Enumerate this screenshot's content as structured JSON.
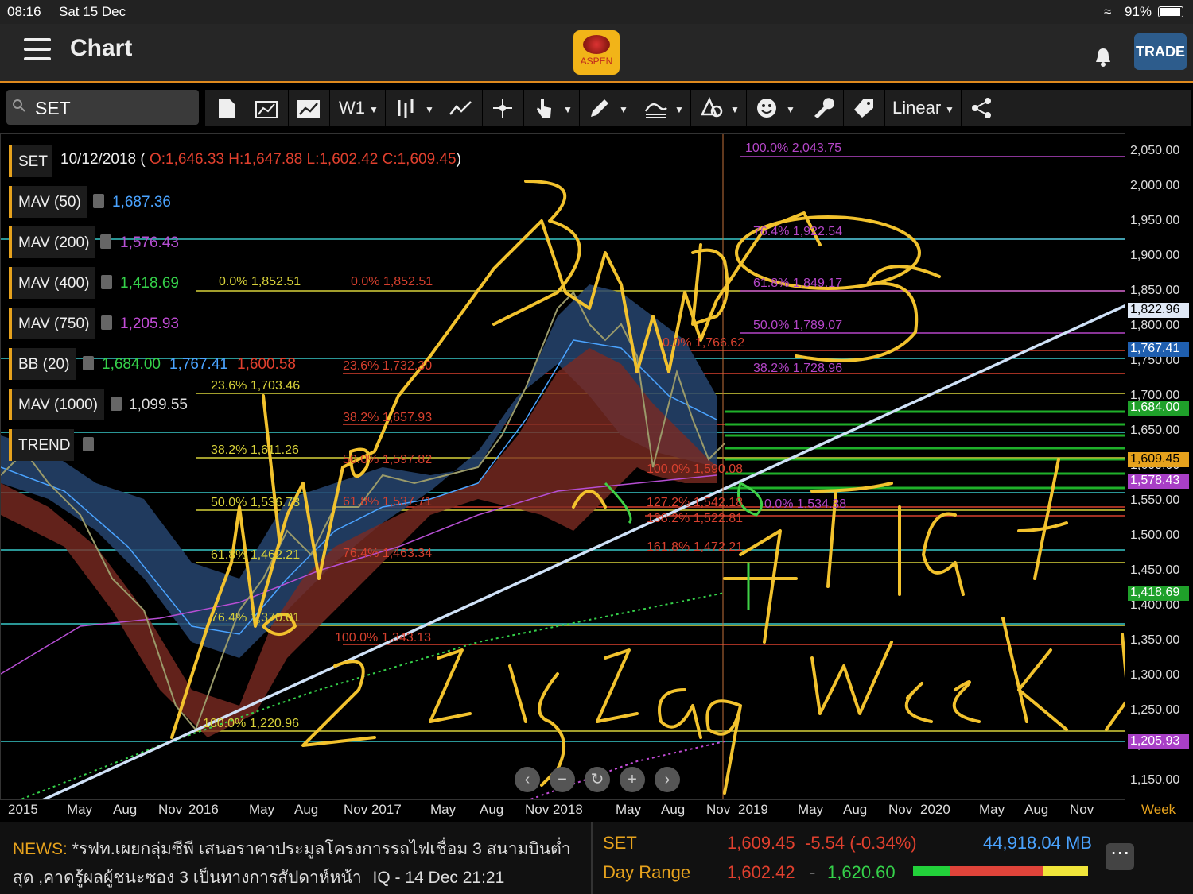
{
  "status": {
    "time": "08:16",
    "date": "Sat 15 Dec",
    "battery": "91%"
  },
  "app": {
    "title": "Chart",
    "logo_text": "ASPEN",
    "trade_button": "TRADE"
  },
  "toolbar": {
    "search_value": "SET",
    "interval": "W1",
    "scale": "Linear",
    "icons": [
      "new-page-icon",
      "open-chart-icon",
      "chart-type-icon",
      "interval-dropdown",
      "bar-style-icon",
      "trend-tool-icon",
      "crosshair-icon",
      "pointer-icon",
      "pencil-icon",
      "fibonacci-icon",
      "shape-icon",
      "emoji-icon",
      "wrench-icon",
      "tag-icon",
      "scale-dropdown",
      "share-icon"
    ]
  },
  "header": {
    "symbol": "SET",
    "date": "10/12/2018",
    "ohlc": "O:1,646.33 H:1,647.88 L:1,602.42 C:1,609.45"
  },
  "indicators": [
    {
      "label": "MAV (50)",
      "value": "1,687.36",
      "color": "#4aa3ff"
    },
    {
      "label": "MAV (200)",
      "value": "1,576.43",
      "color": "#b64ed3"
    },
    {
      "label": "MAV (400)",
      "value": "1,418.69",
      "color": "#35d14a"
    },
    {
      "label": "MAV (750)",
      "value": "1,205.93",
      "color": "#c24cd6"
    },
    {
      "label": "BB (20)",
      "value": "1,684.00",
      "value2": "1,767.41",
      "value3": "1,600.58"
    },
    {
      "label": "MAV (1000)",
      "value": "1,099.55",
      "color": "#dddddd"
    },
    {
      "label": "TREND",
      "value": ""
    }
  ],
  "fib_labels": {
    "yellow": [
      {
        "text": "0.0%  1,852.51"
      },
      {
        "text": "23.6%  1,703.46"
      },
      {
        "text": "38.2%  1,611.26"
      },
      {
        "text": "50.0%  1,536.73"
      },
      {
        "text": "61.8%  1,462.21"
      },
      {
        "text": "76.4%  1,370.01"
      },
      {
        "text": "100.0%  1,220.96"
      }
    ],
    "red": [
      {
        "text": "0.0%  1,852.51"
      },
      {
        "text": "23.6%  1,732.30"
      },
      {
        "text": "38.2%  1,657.93"
      },
      {
        "text": "50.0%  1,597.82"
      },
      {
        "text": "61.8%  1,537.71"
      },
      {
        "text": "76.4%  1,463.34"
      },
      {
        "text": "100.0%  1,343.13"
      },
      {
        "text": "0.0%  1,766.62"
      },
      {
        "text": "100.0%  1,590.08"
      },
      {
        "text": "127.2%  1,542.18"
      },
      {
        "text": "138.2%  1,522.81"
      },
      {
        "text": "161.8%  1,472.21"
      }
    ],
    "magenta": [
      {
        "text": "100.0%  2,043.75"
      },
      {
        "text": "76.4%  1,922.54"
      },
      {
        "text": "61.8%  1,849.17"
      },
      {
        "text": "50.0%  1,789.07"
      },
      {
        "text": "38.2%  1,728.96"
      },
      {
        "text": "0.0%  1,534.38"
      }
    ]
  },
  "handwriting": {
    "wave_labels": [
      "1",
      "2",
      "3",
      "4",
      "5",
      "a",
      "b",
      "c"
    ],
    "notes": [
      "Zigzag",
      "Flat",
      "Week",
      "B"
    ]
  },
  "y_axis": {
    "ticks": [
      "2,050.00",
      "2,000.00",
      "1,950.00",
      "1,900.00",
      "1,850.00",
      "1,800.00",
      "1,750.00",
      "1,700.00",
      "1,650.00",
      "1,600.00",
      "1,550.00",
      "1,500.00",
      "1,450.00",
      "1,400.00",
      "1,350.00",
      "1,300.00",
      "1,250.00",
      "1,200.00",
      "1,150.00"
    ],
    "badges": [
      {
        "text": "1,822.96",
        "bg": "#dfe8f5",
        "fg": "#000000"
      },
      {
        "text": "1,767.41",
        "bg": "#1f5fb0",
        "fg": "#ffffff"
      },
      {
        "text": "1,684.00",
        "bg": "#1fa02a",
        "fg": "#ffffff"
      },
      {
        "text": "1,609.45",
        "bg": "#e6a21d",
        "fg": "#000000"
      },
      {
        "text": "1,578.43",
        "bg": "#a83fc6",
        "fg": "#ffffff"
      },
      {
        "text": "1,418.69",
        "bg": "#1fa02a",
        "fg": "#ffffff"
      },
      {
        "text": "1,205.93",
        "bg": "#a83fc6",
        "fg": "#ffffff"
      }
    ]
  },
  "x_axis": {
    "labels": [
      "2015",
      "May",
      "Aug",
      "Nov",
      "2016",
      "May",
      "Aug",
      "Nov 2017",
      "May",
      "Aug",
      "Nov 2018",
      "May",
      "Aug",
      "Nov",
      "2019",
      "May",
      "Aug",
      "Nov",
      "2020",
      "May",
      "Aug",
      "Nov"
    ],
    "period": "Week"
  },
  "news": {
    "prefix": "NEWS:",
    "text": "*รฟท.เผยกลุ่มซีพี เสนอราคาประมูลโครงการรถไฟเชื่อม 3 สนามบินต่ำสุด ,คาดรู้ผลผู้ชนะซอง 3 เป็นทางการสัปดาห์หน้า",
    "source": "IQ - 14 Dec 21:21"
  },
  "quote": {
    "symbol": "SET",
    "last": "1,609.45",
    "change": "-5.54 (-0.34%)",
    "volume": "44,918.04 MB",
    "range_label": "Day Range",
    "low": "1,602.42",
    "separator": "-",
    "high": "1,620.60"
  }
}
